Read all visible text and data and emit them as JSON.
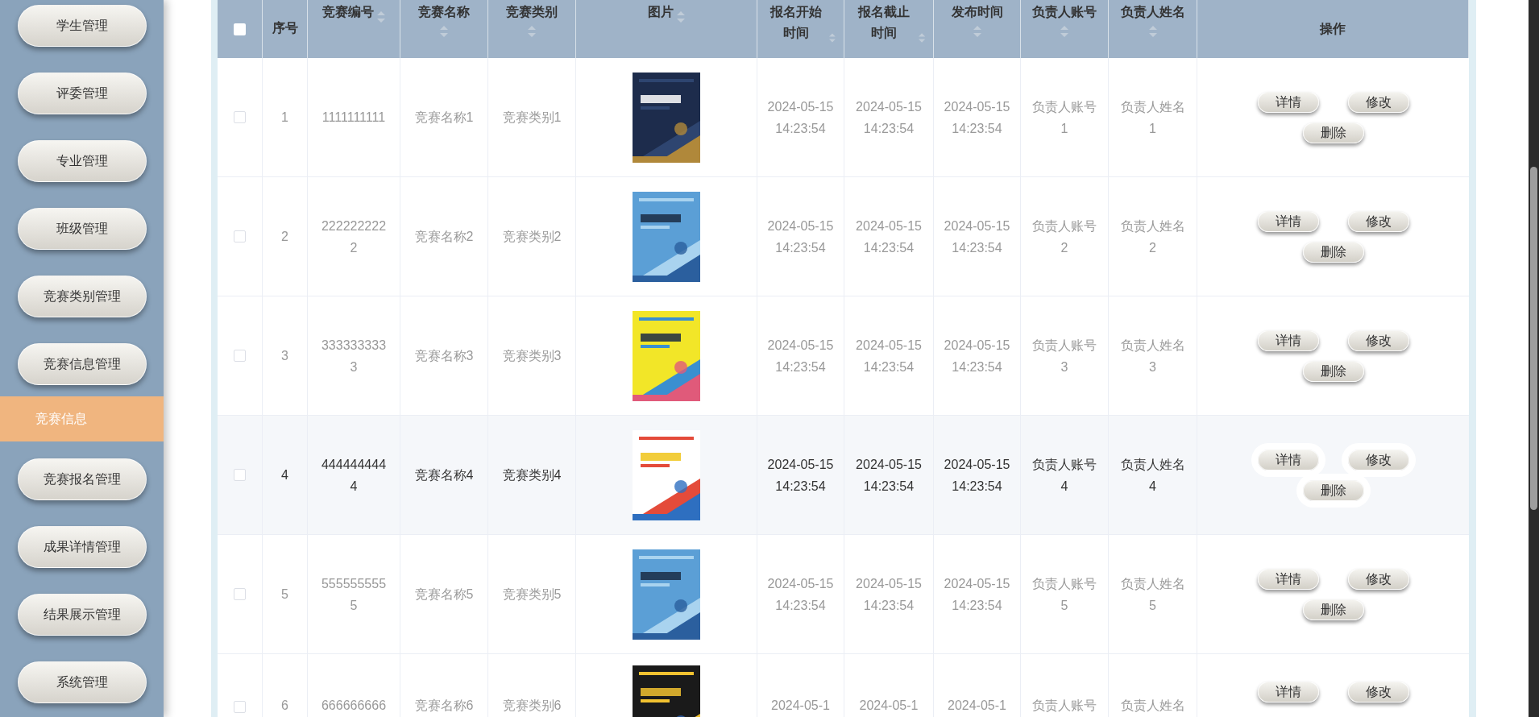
{
  "sidebar": {
    "items": [
      {
        "label": "学生管理",
        "kind": "menu",
        "selected": false
      },
      {
        "label": "评委管理",
        "kind": "menu",
        "selected": false
      },
      {
        "label": "专业管理",
        "kind": "menu",
        "selected": false
      },
      {
        "label": "班级管理",
        "kind": "menu",
        "selected": false
      },
      {
        "label": "竞赛类别管理",
        "kind": "menu",
        "selected": false
      },
      {
        "label": "竞赛信息管理",
        "kind": "menu",
        "selected": false
      },
      {
        "label": "竞赛信息",
        "kind": "submenu",
        "selected": true
      },
      {
        "label": "竞赛报名管理",
        "kind": "menu",
        "selected": false
      },
      {
        "label": "成果详情管理",
        "kind": "menu",
        "selected": false
      },
      {
        "label": "结果展示管理",
        "kind": "menu",
        "selected": false
      },
      {
        "label": "系统管理",
        "kind": "menu",
        "selected": false
      }
    ]
  },
  "table": {
    "select_all": {
      "checked": false
    },
    "columns": [
      {
        "label": "序号",
        "sortable": false
      },
      {
        "label": "竞赛编号",
        "sortable": true
      },
      {
        "label": "竞赛名称",
        "sortable": true
      },
      {
        "label": "竞赛类别",
        "sortable": true
      },
      {
        "label": "图片",
        "sortable": true
      },
      {
        "label": "报名开始时间",
        "sortable": true
      },
      {
        "label": "报名截止时间",
        "sortable": true
      },
      {
        "label": "发布时间",
        "sortable": true
      },
      {
        "label": "负责人账号",
        "sortable": true
      },
      {
        "label": "负责人姓名",
        "sortable": true
      },
      {
        "label": "操作",
        "sortable": false
      }
    ],
    "rows": [
      {
        "checked": false,
        "highlighted": false,
        "cells": [
          "1",
          "1111111111",
          "竞赛名称1",
          "竞赛类别1",
          {
            "kind": "picture"
          },
          "2024-05-15 14:23:54",
          "2024-05-15 14:23:54",
          "2024-05-15 14:23:54",
          "负责人账号1",
          "负责人姓名1"
        ],
        "actions": [
          "详情",
          "修改",
          "删除"
        ]
      },
      {
        "checked": false,
        "highlighted": false,
        "cells": [
          "2",
          "2222222222",
          "竞赛名称2",
          "竞赛类别2",
          {
            "kind": "picture"
          },
          "2024-05-15 14:23:54",
          "2024-05-15 14:23:54",
          "2024-05-15 14:23:54",
          "负责人账号2",
          "负责人姓名2"
        ],
        "actions": [
          "详情",
          "修改",
          "删除"
        ]
      },
      {
        "checked": false,
        "highlighted": false,
        "cells": [
          "3",
          "3333333333",
          "竞赛名称3",
          "竞赛类别3",
          {
            "kind": "picture"
          },
          "2024-05-15 14:23:54",
          "2024-05-15 14:23:54",
          "2024-05-15 14:23:54",
          "负责人账号3",
          "负责人姓名3"
        ],
        "actions": [
          "详情",
          "修改",
          "删除"
        ]
      },
      {
        "checked": false,
        "highlighted": true,
        "cells": [
          "4",
          "4444444444",
          "竞赛名称4",
          "竞赛类别4",
          {
            "kind": "picture"
          },
          "2024-05-15 14:23:54",
          "2024-05-15 14:23:54",
          "2024-05-15 14:23:54",
          "负责人账号4",
          "负责人姓名4"
        ],
        "actions": [
          "详情",
          "修改",
          "删除"
        ]
      },
      {
        "checked": false,
        "highlighted": false,
        "cells": [
          "5",
          "5555555555",
          "竞赛名称5",
          "竞赛类别5",
          {
            "kind": "picture"
          },
          "2024-05-15 14:23:54",
          "2024-05-15 14:23:54",
          "2024-05-15 14:23:54",
          "负责人账号5",
          "负责人姓名5"
        ],
        "actions": [
          "详情",
          "修改",
          "删除"
        ]
      },
      {
        "checked": false,
        "highlighted": false,
        "cells": [
          "6",
          "666666666",
          "竞赛名称6",
          "竞赛类别6",
          {
            "kind": "picture"
          },
          "2024-05-1",
          "2024-05-1",
          "2024-05-1",
          "负责人账号",
          "负责人姓名"
        ],
        "actions": [
          "详情",
          "修改"
        ]
      }
    ]
  }
}
